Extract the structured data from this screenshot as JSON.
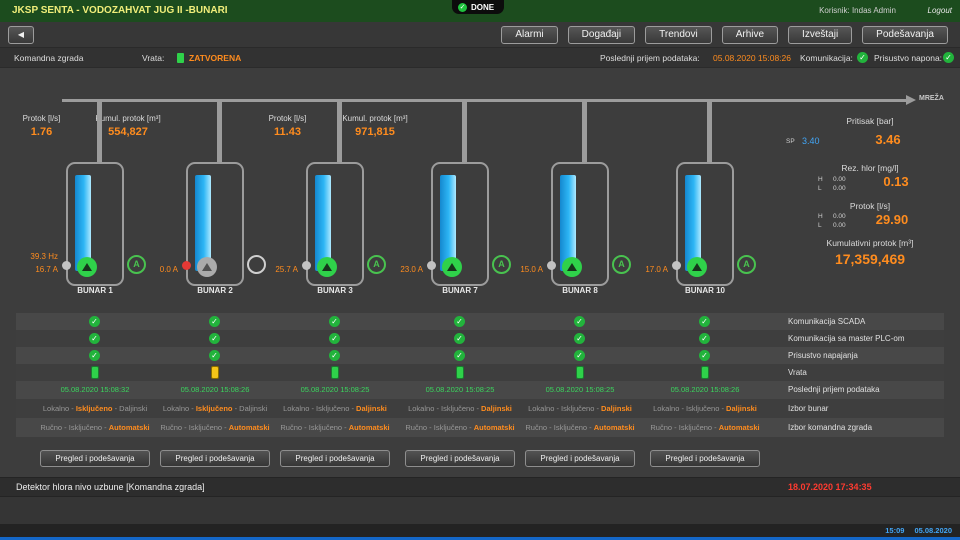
{
  "header": {
    "title": "JKSP SENTA - VODOZAHVAT JUG II -BUNARI",
    "user": "Korisnik: Indas Admin",
    "logout": "Logout"
  },
  "done_badge": {
    "label": "DONE"
  },
  "icons": {
    "check": "✓",
    "auto": "A",
    "back": "◀"
  },
  "nav": {
    "tabs": [
      "Alarmi",
      "Događaji",
      "Trendovi",
      "Arhive",
      "Izveštaji",
      "Podešavanja"
    ]
  },
  "status_bar": {
    "location": "Komandna zgrada",
    "door_label": "Vrata:",
    "door_value": "ZATVORENA",
    "last_label": "Poslednji prijem podataka:",
    "last_value": "05.08.2020 15:08:26",
    "comm_label": "Komunikacija:",
    "voltage_label": "Prisustvo napona:"
  },
  "network": {
    "label": "MREŽA"
  },
  "flow_groups": [
    {
      "flow_label": "Protok [l/s]",
      "flow_value": "1.76",
      "cumul_label": "Kumul. protok [m³]",
      "cumul_value": "554,827"
    },
    {
      "flow_label": "Protok [l/s]",
      "flow_value": "11.43",
      "cumul_label": "Kumul. protok [m³]",
      "cumul_value": "971,815"
    }
  ],
  "wells": [
    {
      "name": "BUNAR 1",
      "freq": "39.3 Hz",
      "current": "16.7 A",
      "state": "running"
    },
    {
      "name": "BUNAR 2",
      "freq": "",
      "current": "0.0 A",
      "state": "stopped"
    },
    {
      "name": "BUNAR 3",
      "freq": "",
      "current": "25.7 A",
      "state": "running"
    },
    {
      "name": "BUNAR 7",
      "freq": "",
      "current": "23.0 A",
      "state": "running"
    },
    {
      "name": "BUNAR 8",
      "freq": "",
      "current": "15.0 A",
      "state": "running"
    },
    {
      "name": "BUNAR 10",
      "freq": "",
      "current": "17.0 A",
      "state": "running"
    }
  ],
  "right_panel": {
    "pressure": {
      "label": "Pritisak [bar]",
      "sp_label": "SP",
      "sp_value": "3.40",
      "value": "3.46"
    },
    "chlorine": {
      "label": "Rez. hlor [mg/l]",
      "h_label": "H",
      "h_value": "0.00",
      "l_label": "L",
      "l_value": "0.00",
      "value": "0.13"
    },
    "flow": {
      "label": "Protok [l/s]",
      "h_label": "H",
      "h_value": "0.00",
      "l_label": "L",
      "l_value": "0.00",
      "value": "29.90"
    },
    "cumulative": {
      "label": "Kumulativni protok [m³]",
      "value": "17,359,469"
    }
  },
  "table": {
    "labels": [
      "Komunikacija SCADA",
      "Komunikacija sa master PLC-om",
      "Prisustvo napajanja",
      "Vrata",
      "Poslednji prijem podataka",
      "Izbor bunar",
      "Izbor komandna zgrada"
    ],
    "timestamps": [
      "05.08.2020 15:08:32",
      "05.08.2020 15:08:26",
      "05.08.2020 15:08:25",
      "05.08.2020 15:08:25",
      "05.08.2020 15:08:25",
      "05.08.2020 15:08:26"
    ],
    "doors": [
      "ok",
      "warn",
      "ok",
      "ok",
      "ok",
      "ok"
    ],
    "izbor_bunar": [
      {
        "pre": "Lokalno - ",
        "sel": "Isključeno",
        "post": " - Daljinski"
      },
      {
        "pre": "Lokalno - ",
        "sel": "Isključeno",
        "post": " - Daljinski"
      },
      {
        "pre": "Lokalno - Isključeno - ",
        "sel": "Daljinski",
        "post": ""
      },
      {
        "pre": "Lokalno - Isključeno - ",
        "sel": "Daljinski",
        "post": ""
      },
      {
        "pre": "Lokalno - Isključeno - ",
        "sel": "Daljinski",
        "post": ""
      },
      {
        "pre": "Lokalno - Isključeno - ",
        "sel": "Daljinski",
        "post": ""
      }
    ],
    "izbor_zgrada": [
      {
        "pre": "Ručno - Isključeno - ",
        "sel": "Automatski",
        "post": ""
      },
      {
        "pre": "Ručno - Isključeno - ",
        "sel": "Automatski",
        "post": ""
      },
      {
        "pre": "Ručno - Isključeno - ",
        "sel": "Automatski",
        "post": ""
      },
      {
        "pre": "Ručno - Isključeno - ",
        "sel": "Automatski",
        "post": ""
      },
      {
        "pre": "Ručno - Isključeno - ",
        "sel": "Automatski",
        "post": ""
      },
      {
        "pre": "Ručno - Isključeno - ",
        "sel": "Automatski",
        "post": ""
      }
    ]
  },
  "buttons": {
    "pregled": "Pregled i podešavanja"
  },
  "alarm": {
    "message": "Detektor hlora nivo uzbune [Komandna zgrada]",
    "timestamp": "18.07.2020 17:34:35"
  },
  "footer": {
    "time": "15:09",
    "date": "05.08.2020"
  },
  "colors": {
    "accent_orange": "#ff8c1e",
    "ok_green": "#2fd14a",
    "alarm_red": "#ff3b30",
    "link_blue": "#42a5f5"
  }
}
